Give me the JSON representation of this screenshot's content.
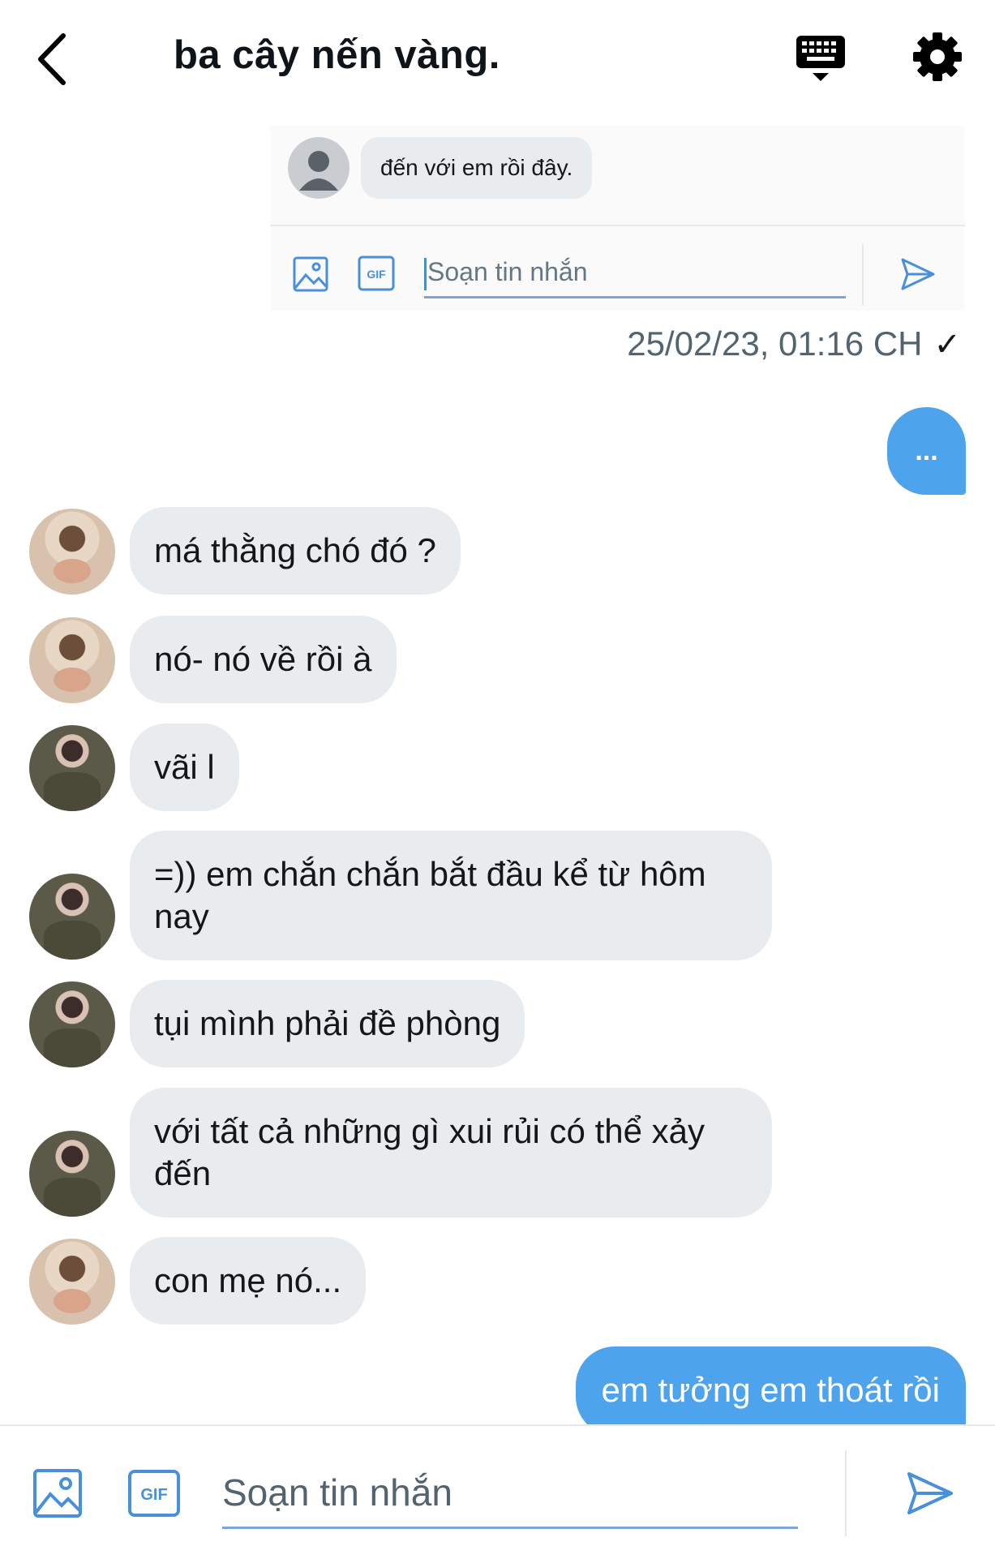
{
  "header": {
    "title": "ba cây nến vàng."
  },
  "embedded_preview": {
    "message": "đến với em rồi đây.",
    "compose_placeholder": "Soạn tin nhắn"
  },
  "timestamp": "25/02/23, 01:16 CH",
  "timestamp_status": "✓",
  "typing_indicator": "...",
  "messages": [
    {
      "text": "má thằng chó đó ?",
      "avatar": "avatar-a"
    },
    {
      "text": "nó- nó về rồi à",
      "avatar": "avatar-a"
    },
    {
      "text": "vãi l",
      "avatar": "avatar-b"
    },
    {
      "text": "=)) em chắn chắn bắt đầu kể từ hôm nay",
      "avatar": "avatar-b"
    },
    {
      "text": "tụi mình phải đề phòng",
      "avatar": "avatar-b"
    },
    {
      "text": "với tất cả những gì xui rủi có thể xảy đến",
      "avatar": "avatar-b"
    },
    {
      "text": "con mẹ nó...",
      "avatar": "avatar-a"
    }
  ],
  "sent_message": "em tưởng em thoát rồi",
  "footer": {
    "compose_placeholder": "Soạn tin nhắn",
    "gif_label": "GIF"
  },
  "colors": {
    "accent": "#4da3ec",
    "bubble": "#e9ecef",
    "icon_blue": "#4a90d9"
  }
}
